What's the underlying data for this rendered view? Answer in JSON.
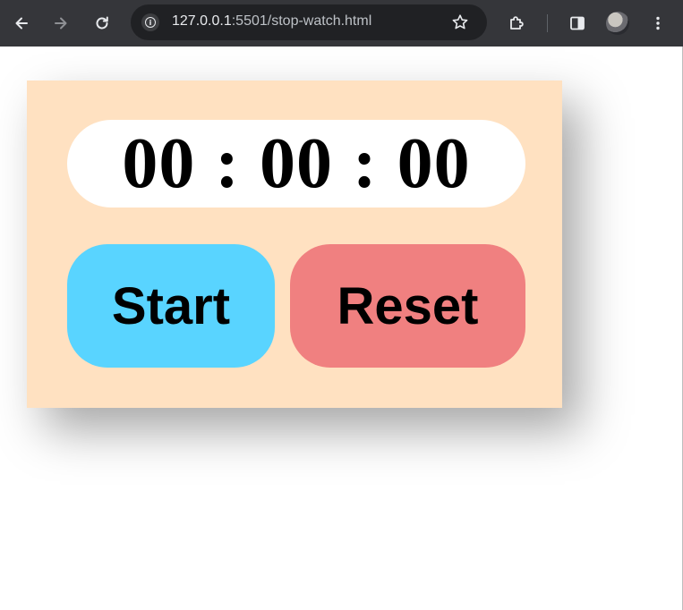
{
  "browser": {
    "url_host": "127.0.0.1",
    "url_path": ":5501/stop-watch.html",
    "icons": {
      "back": "arrow-left-icon",
      "forward": "arrow-right-icon",
      "reload": "reload-icon",
      "site_info": "info-icon",
      "bookmark": "star-icon",
      "extensions": "puzzle-icon",
      "side_panel": "side-panel-icon",
      "profile": "avatar",
      "menu": "kebab-menu-icon"
    }
  },
  "stopwatch": {
    "hours": "00",
    "minutes": "00",
    "seconds": "00",
    "separator": ":",
    "start_label": "Start",
    "reset_label": "Reset",
    "colors": {
      "card": "#ffe1c1",
      "display": "#ffffff",
      "start": "#59d4ff",
      "reset": "#f08080"
    }
  }
}
